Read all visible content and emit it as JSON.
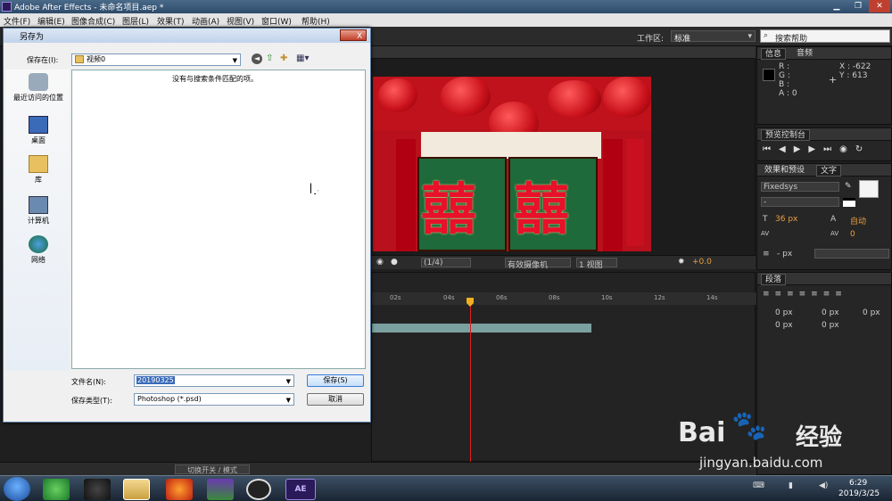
{
  "window": {
    "title": "Adobe After Effects - 未命名项目.aep *"
  },
  "menu": [
    "文件(F)",
    "编辑(E)",
    "图像合成(C)",
    "图层(L)",
    "效果(T)",
    "动画(A)",
    "视图(V)",
    "窗口(W)",
    "帮助(H)"
  ],
  "toolbar": {
    "workspace_label": "工作区:",
    "workspace_value": "标准",
    "search_placeholder": "搜索帮助"
  },
  "info_panel": {
    "tab_info": "信息",
    "tab_audio": "音频",
    "r": "R :",
    "g": "G :",
    "b": "B :",
    "a": "A : 0",
    "x": "X : -622",
    "y": "Y : 613"
  },
  "preview_panel": {
    "title": "预览控制台"
  },
  "effects_tabs": {
    "effects": "效果和预设",
    "text": "文字"
  },
  "text_panel": {
    "font": "Fixedsys",
    "style": "-",
    "size": "36 px",
    "leading": "自动",
    "kerning": "0",
    "indent": "- px"
  },
  "paragraph_panel": {
    "title": "段落",
    "v1": "0 px",
    "v2": "0 px",
    "v3": "0 px",
    "v4": "0 px",
    "v5": "0 px"
  },
  "viewer_controls": {
    "zoom": "(1/4)",
    "camera": "有效摄像机",
    "views": "1 视图",
    "offset": "+0.0"
  },
  "timeline": {
    "ticks": [
      "02s",
      "04s",
      "06s",
      "08s",
      "10s",
      "12s",
      "14s"
    ],
    "switches": "切换开关 / 模式"
  },
  "image": {
    "char": "囍"
  },
  "dialog": {
    "title": "另存为",
    "save_in_label": "保存在(I):",
    "folder": "视频0",
    "empty_message": "没有与搜索条件匹配的项。",
    "places": [
      "最近访问的位置",
      "桌面",
      "库",
      "计算机",
      "网络"
    ],
    "filename_label": "文件名(N):",
    "filename_value": "20190325",
    "filetype_label": "保存类型(T):",
    "filetype_value": "Photoshop (*.psd)",
    "save_button": "保存(S)",
    "cancel_button": "取消",
    "close": "X"
  },
  "taskbar": {
    "time": "6:29",
    "date": "2019/3/25",
    "ae": "AE"
  },
  "watermark": {
    "brand": "Bai",
    "brand2": "经验",
    "url": "jingyan.baidu.com"
  },
  "colors": {
    "accent_red": "#e8102a",
    "dialog_bg": "#f0f0f0",
    "panel": "#262626"
  }
}
